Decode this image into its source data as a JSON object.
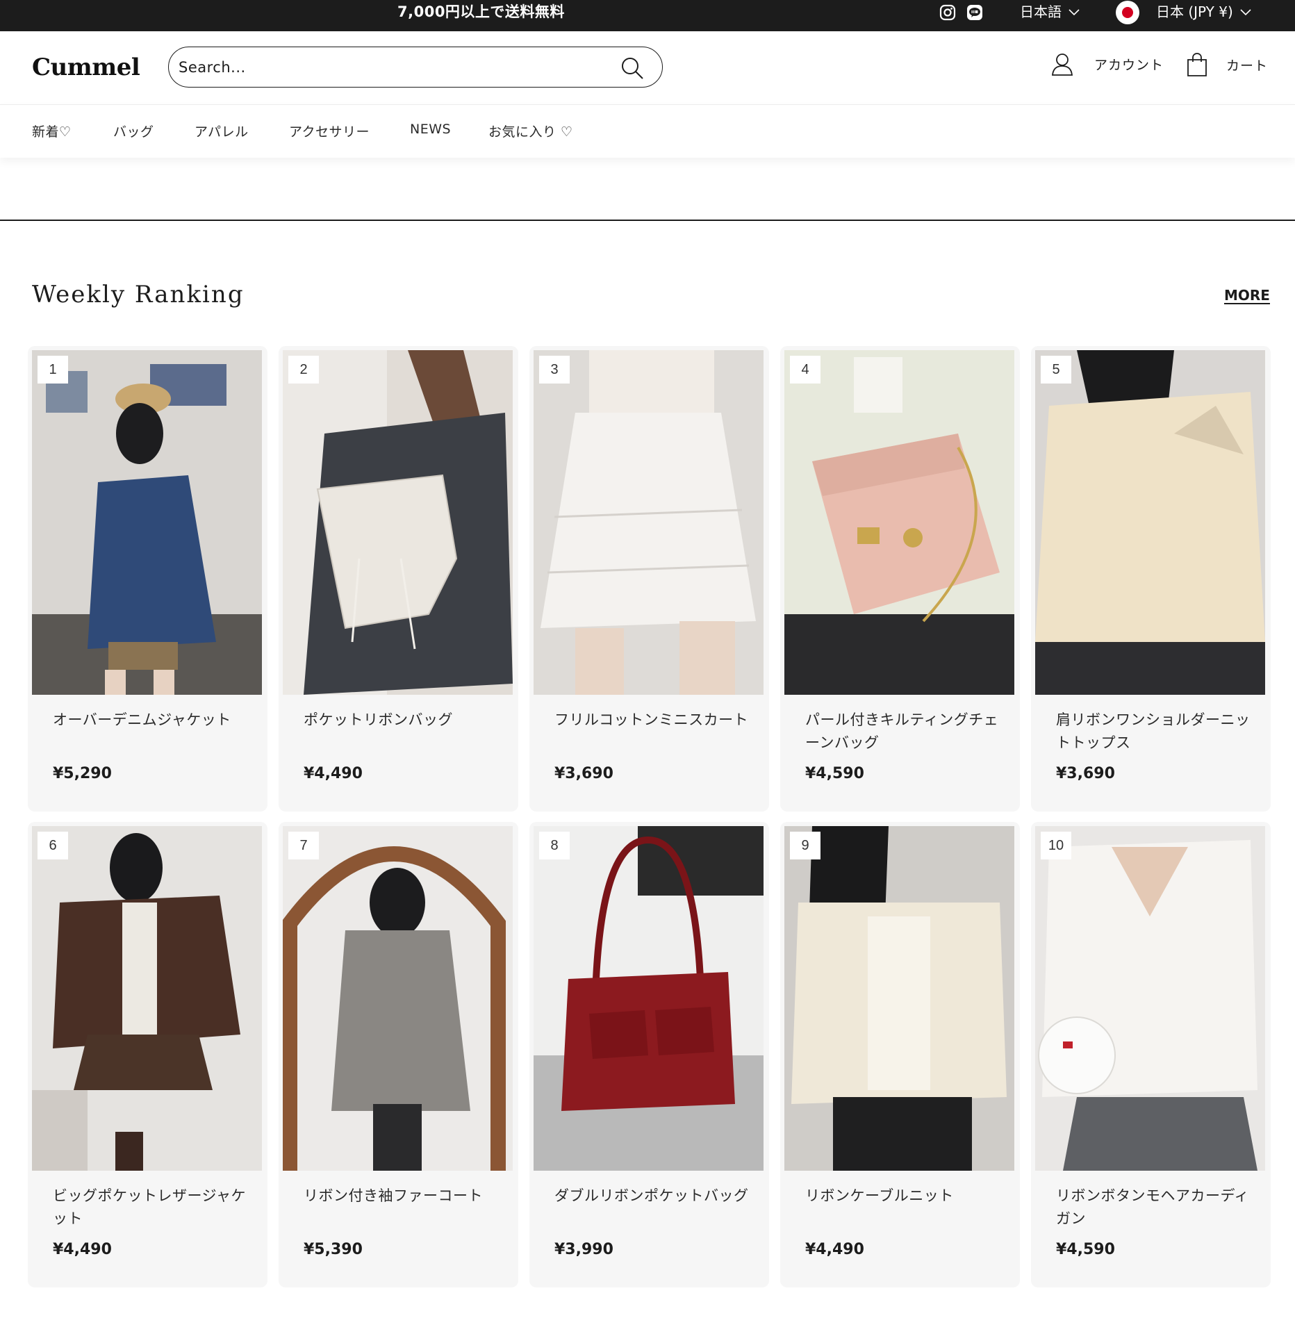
{
  "announcement": {
    "promo": "7,000円以上で送料無料",
    "language": "日本語",
    "currency": "日本 (JPY ¥)"
  },
  "header": {
    "logo": "Cummel",
    "search_placeholder": "Search...",
    "account_label": "アカウント",
    "cart_label": "カート"
  },
  "nav": {
    "items": [
      "新着♡",
      "バッグ",
      "アパレル",
      "アクセサリー",
      "NEWS",
      "お気に入り ♡"
    ]
  },
  "section": {
    "title": "Weekly Ranking",
    "more_label": "MORE"
  },
  "products": [
    {
      "rank": "1",
      "name": "オーバーデニムジャケット",
      "price": "¥5,290"
    },
    {
      "rank": "2",
      "name": "ポケットリボンバッグ",
      "price": "¥4,490"
    },
    {
      "rank": "3",
      "name": "フリルコットンミニスカート",
      "price": "¥3,690"
    },
    {
      "rank": "4",
      "name": "パール付きキルティングチェーンバッグ",
      "price": "¥4,590"
    },
    {
      "rank": "5",
      "name": "肩リボンワンショルダーニットトップス",
      "price": "¥3,690"
    },
    {
      "rank": "6",
      "name": "ビッグポケットレザージャケット",
      "price": "¥4,490"
    },
    {
      "rank": "7",
      "name": "リボン付き袖ファーコート",
      "price": "¥5,390"
    },
    {
      "rank": "8",
      "name": "ダブルリボンポケットバッグ",
      "price": "¥3,990"
    },
    {
      "rank": "9",
      "name": "リボンケーブルニット",
      "price": "¥4,490"
    },
    {
      "rank": "10",
      "name": "リボンボタンモヘアカーディガン",
      "price": "¥4,590"
    }
  ],
  "icons": {
    "instagram": "instagram-icon",
    "line": "line-icon",
    "search": "search-icon",
    "account": "user-icon",
    "cart": "shopping-bag-icon"
  }
}
